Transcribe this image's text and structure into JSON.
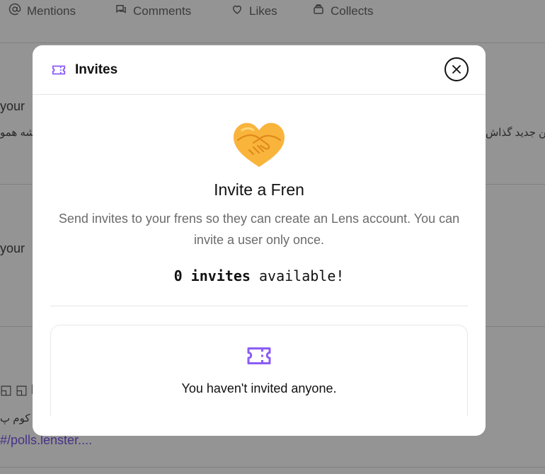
{
  "background": {
    "tabs": [
      {
        "label": "Mentions",
        "icon": "at-icon"
      },
      {
        "label": "Comments",
        "icon": "chat-icon"
      },
      {
        "label": "Likes",
        "icon": "heart-icon"
      },
      {
        "label": "Collects",
        "icon": "collect-icon"
      }
    ],
    "snippet_1": "your",
    "snippet_rtl_1a": "بن جدید گذاش",
    "snippet_rtl_1b": "شه همو",
    "snippet_2": "your",
    "snippet_3": "◱ ◱ lik",
    "snippet_rtl_3": "ن کوم پ",
    "link": "#/polls.lenster...."
  },
  "modal": {
    "title": "Invites",
    "title_icon": "ticket-icon",
    "close_icon": "close-icon",
    "emoji": "handshake-icon",
    "heading": "Invite a Fren",
    "description": "Send invites to your frens so they can create an Lens account. You can invite a user only once.",
    "count": "0",
    "count_word": "invites",
    "count_suffix": "available!",
    "empty_icon": "ticket-icon",
    "empty_text": "You haven't invited anyone.",
    "accent_color": "#8b5cf6"
  }
}
